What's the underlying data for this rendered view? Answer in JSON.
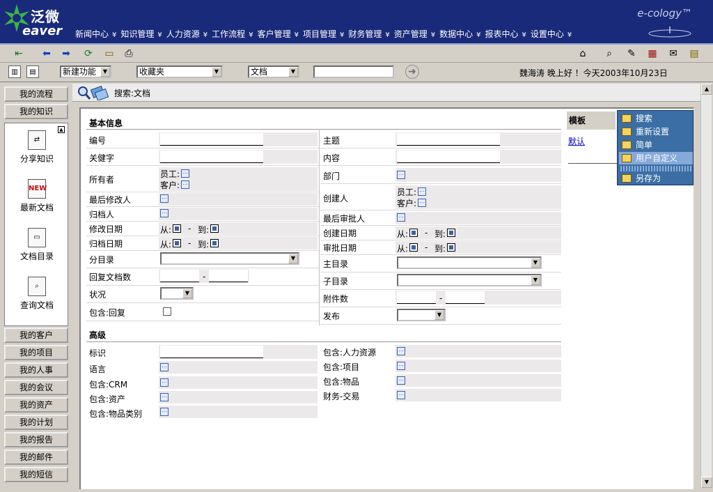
{
  "app": {
    "logo_top": "泛微",
    "logo_bottom": "eaver",
    "brand": "e-cology™"
  },
  "nav": [
    {
      "label": "新闻中心"
    },
    {
      "label": "知识管理"
    },
    {
      "label": "人力资源"
    },
    {
      "label": "工作流程"
    },
    {
      "label": "客户管理"
    },
    {
      "label": "项目管理"
    },
    {
      "label": "财务管理"
    },
    {
      "label": "资产管理"
    },
    {
      "label": "数据中心"
    },
    {
      "label": "报表中心"
    },
    {
      "label": "设置中心"
    }
  ],
  "toolbar2": {
    "new_function": "新建功能",
    "favorites": "收藏夹",
    "doc_type": "文档",
    "search_value": "",
    "greeting": "魏海涛 晚上好 ！今天2003年10月23日"
  },
  "sidebar": {
    "top_buttons": [
      "我的流程",
      "我的知识"
    ],
    "tools": [
      "分享知识",
      "最新文档",
      "文档目录",
      "查询文档"
    ],
    "bottom_buttons": [
      "我的客户",
      "我的项目",
      "我的人事",
      "我的会议",
      "我的资产",
      "我的计划",
      "我的报告",
      "我的邮件",
      "我的短信"
    ]
  },
  "main": {
    "title": "搜索:文档"
  },
  "form": {
    "basic_title": "基本信息",
    "advanced_title": "高级",
    "left": {
      "code": "编号",
      "keyword": "关健字",
      "owner": "所有者",
      "employee": "员工:",
      "customer": "客户:",
      "last_modifier": "最后修改人",
      "archiver": "归档人",
      "modified_date": "修改日期",
      "archive_date": "归档日期",
      "from": "从:",
      "to": "到:",
      "dash": "-",
      "subcategory": "分目录",
      "reply_count": "回复文档数",
      "status": "状况",
      "include_reply": "包含:回复"
    },
    "right": {
      "subject": "主题",
      "content": "内容",
      "department": "部门",
      "creator": "创建人",
      "last_approver": "最后审批人",
      "create_date": "创建日期",
      "approve_date": "审批日期",
      "main_category": "主目录",
      "sub_category": "子目录",
      "attachments": "附件数",
      "publish": "发布"
    },
    "adv_left": [
      "标识",
      "语言",
      "包含:CRM",
      "包含:资产",
      "包含:物品类别"
    ],
    "adv_right": [
      "包含:人力资源",
      "包含:项目",
      "包含:物品",
      "财务-交易"
    ]
  },
  "template": {
    "title": "模板",
    "default_link": "默认"
  },
  "menu": {
    "items": [
      "搜索",
      "重新设置",
      "简单",
      "用户自定义",
      "另存为"
    ],
    "selected_index": 3
  }
}
